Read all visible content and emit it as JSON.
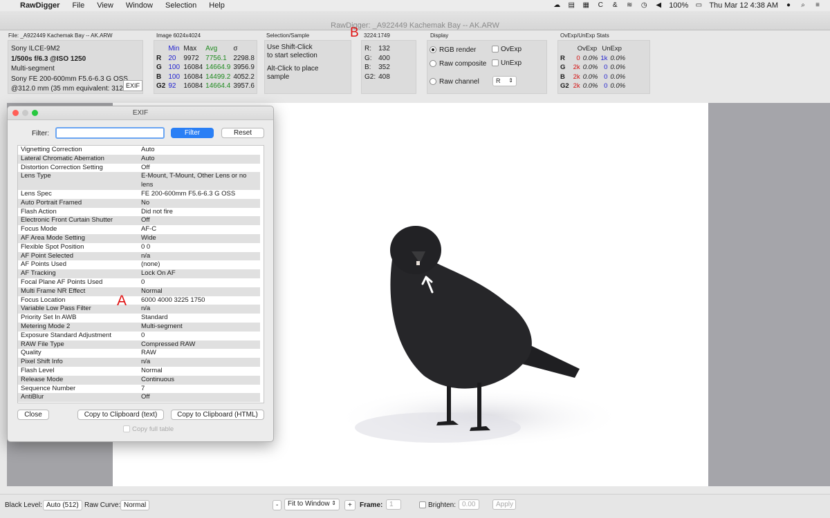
{
  "menubar": {
    "app_name": "RawDigger",
    "items": [
      "File",
      "View",
      "Window",
      "Selection",
      "Help"
    ],
    "battery": "100%",
    "datetime": "Thu Mar 12  4:38 AM"
  },
  "window": {
    "title": "RawDigger: _A922449 Kachemak Bay -- AK.ARW"
  },
  "file_panel": {
    "label": "File: _A922449 Kachemak Bay -- AK.ARW",
    "camera": "Sony ILCE-9M2",
    "exposure": "1/500s f/6.3 @ISO 1250",
    "mode": "Multi-segment",
    "lens": "Sony FE 200-600mm F5.6-6.3 G OSS",
    "focal": "@312.0 mm (35 mm equivalent: 312.0",
    "exif_button": "EXIF"
  },
  "image_panel": {
    "label": "Image 6024x4024",
    "headers": [
      "",
      "Min",
      "Max",
      "Avg",
      "σ"
    ],
    "rows": [
      {
        "ch": "R",
        "min": "20",
        "max": "9972",
        "avg": "7756.1",
        "sd": "2298.8"
      },
      {
        "ch": "G",
        "min": "100",
        "max": "16084",
        "avg": "14664.9",
        "sd": "3956.9"
      },
      {
        "ch": "B",
        "min": "100",
        "max": "16084",
        "avg": "14499.2",
        "sd": "4052.2"
      },
      {
        "ch": "G2",
        "min": "92",
        "max": "16084",
        "avg": "14664.4",
        "sd": "3957.6"
      }
    ]
  },
  "selection_panel": {
    "label": "Selection/Sample",
    "line1": "Use Shift-Click",
    "line2": "to start selection",
    "line3": "Alt-Click to place",
    "line4": "sample"
  },
  "sample_panel": {
    "marker": "B",
    "label": "3224:1749",
    "rows": [
      {
        "ch": "R:",
        "val": "132"
      },
      {
        "ch": "G:",
        "val": "400"
      },
      {
        "ch": "B:",
        "val": "352"
      },
      {
        "ch": "G2:",
        "val": "408"
      }
    ]
  },
  "display_panel": {
    "label": "Display",
    "rgb_render": "RGB render",
    "raw_composite": "Raw composite",
    "raw_channel": "Raw channel",
    "ovexp": "OvExp",
    "unexp": "UnExp",
    "channel_value": "R"
  },
  "stats_panel": {
    "label": "OvExp/UnExp Stats",
    "head_ov": "OvExp",
    "head_un": "UnExp",
    "rows": [
      {
        "ch": "R",
        "ovn": "0",
        "ovp": "0.0%",
        "unn": "1k",
        "unp": "0.0%"
      },
      {
        "ch": "G",
        "ovn": "2k",
        "ovp": "0.0%",
        "unn": "0",
        "unp": "0.0%"
      },
      {
        "ch": "B",
        "ovn": "2k",
        "ovp": "0.0%",
        "unn": "0",
        "unp": "0.0%"
      },
      {
        "ch": "G2",
        "ovn": "2k",
        "ovp": "0.0%",
        "unn": "0",
        "unp": "0.0%"
      }
    ]
  },
  "exif_dialog": {
    "title": "EXIF",
    "filter_label": "Filter:",
    "filter_value": "",
    "filter_button": "Filter",
    "reset_button": "Reset",
    "marker": "A",
    "rows": [
      {
        "k": "Vignetting Correction",
        "v": "Auto"
      },
      {
        "k": "Lateral Chromatic Aberration",
        "v": "Auto"
      },
      {
        "k": "Distortion Correction Setting",
        "v": "Off"
      },
      {
        "k": "Lens Type",
        "v": "E-Mount, T-Mount, Other Lens or no lens"
      },
      {
        "k": "Lens Spec",
        "v": "FE 200-600mm F5.6-6.3 G OSS"
      },
      {
        "k": "Auto Portrait Framed",
        "v": "No"
      },
      {
        "k": "Flash Action",
        "v": "Did not fire"
      },
      {
        "k": "Electronic Front Curtain Shutter",
        "v": "Off"
      },
      {
        "k": "Focus Mode",
        "v": "AF-C"
      },
      {
        "k": "AF Area Mode Setting",
        "v": "Wide"
      },
      {
        "k": "Flexible Spot Position",
        "v": "0 0"
      },
      {
        "k": "AF Point Selected",
        "v": "n/a"
      },
      {
        "k": "AF Points Used",
        "v": "(none)"
      },
      {
        "k": "AF Tracking",
        "v": "Lock On AF"
      },
      {
        "k": "Focal Plane AF Points Used",
        "v": "0"
      },
      {
        "k": "Multi Frame NR Effect",
        "v": "Normal"
      },
      {
        "k": "Focus Location",
        "v": "6000 4000 3225 1750"
      },
      {
        "k": "Variable Low Pass Filter",
        "v": "n/a"
      },
      {
        "k": "Priority Set In AWB",
        "v": "Standard"
      },
      {
        "k": "Metering Mode 2",
        "v": "Multi-segment"
      },
      {
        "k": "Exposure Standard Adjustment",
        "v": "0"
      },
      {
        "k": "RAW File Type",
        "v": "Compressed RAW"
      },
      {
        "k": "Quality",
        "v": "RAW"
      },
      {
        "k": "Pixel Shift Info",
        "v": "n/a"
      },
      {
        "k": "Flash Level",
        "v": "Normal"
      },
      {
        "k": "Release Mode",
        "v": "Continuous"
      },
      {
        "k": "Sequence Number",
        "v": "7"
      },
      {
        "k": "AntiBlur",
        "v": "Off"
      }
    ],
    "close_button": "Close",
    "copy_text_button": "Copy to Clipboard (text)",
    "copy_html_button": "Copy to Clipboard (HTML)",
    "copy_full_table": "Copy full table"
  },
  "bottom": {
    "black_level_label": "Black Level:",
    "black_level_value": "Auto (512)",
    "raw_curve_label": "Raw Curve:",
    "raw_curve_value": "Normal",
    "zoom_minus": "-",
    "zoom_value": "Fit to Window",
    "zoom_plus": "+",
    "frame_label": "Frame:",
    "frame_value": "1",
    "brighten_label": "Brighten:",
    "brighten_value": "0.00",
    "apply_button": "Apply"
  },
  "colors": {
    "marker_red": "#e01010",
    "min_blue": "#1f1fcf",
    "avg_green": "#1e8a1e",
    "filter_button_blue": "#2a7ff5"
  }
}
